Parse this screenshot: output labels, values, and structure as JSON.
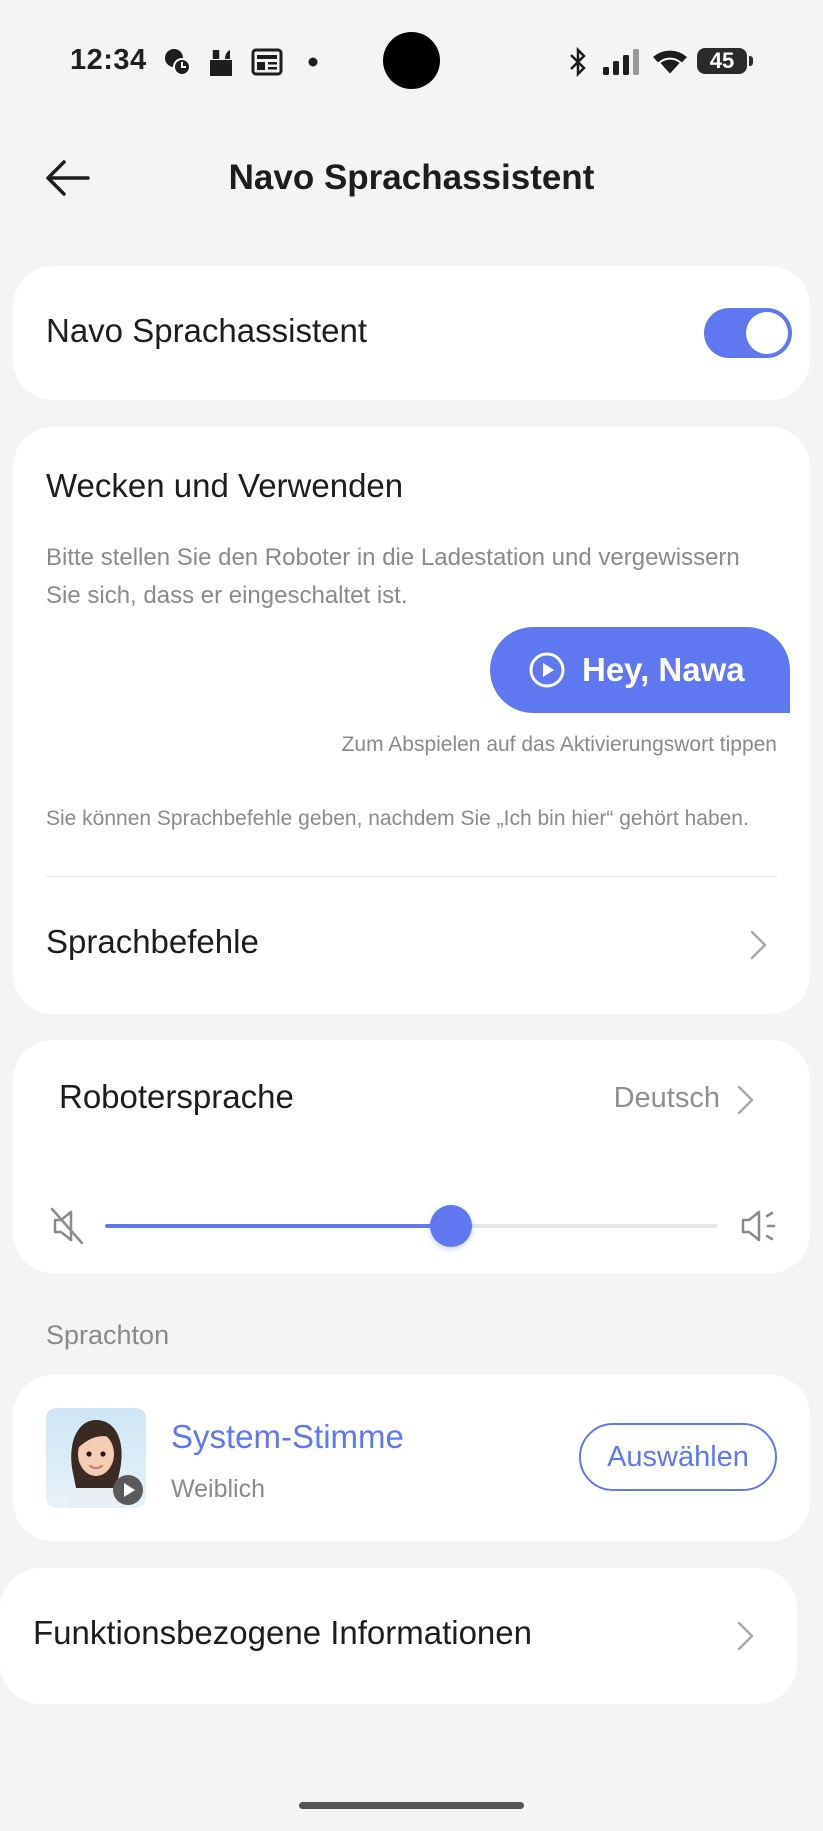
{
  "status_bar": {
    "time": "12:34",
    "battery": "45"
  },
  "header": {
    "title": "Navo Sprachassistent"
  },
  "assistant_card": {
    "label": "Navo Sprachassistent",
    "enabled": true
  },
  "wake_card": {
    "title": "Wecken und Verwenden",
    "description": "Bitte stellen Sie den Roboter in die Ladestation und vergewissern Sie sich, dass er eingeschaltet ist.",
    "wake_word": "Hey, Nawa",
    "tap_hint": "Zum Abspielen auf das Aktivierungswort tippen",
    "after_hint": "Sie können Sprachbefehle geben, nachdem Sie „Ich bin hier“ gehört haben.",
    "commands_label": "Sprachbefehle"
  },
  "language_card": {
    "label": "Robotersprache",
    "value": "Deutsch",
    "volume_fraction": 0.565
  },
  "voice_section": {
    "label": "Sprachton",
    "voice_name": "System-Stimme",
    "voice_gender": "Weiblich",
    "select_label": "Auswählen"
  },
  "info_card": {
    "label": "Funktionsbezogene Informationen"
  },
  "colors": {
    "accent": "#6078ef",
    "background": "#f4f4f4",
    "card": "#ffffff"
  }
}
